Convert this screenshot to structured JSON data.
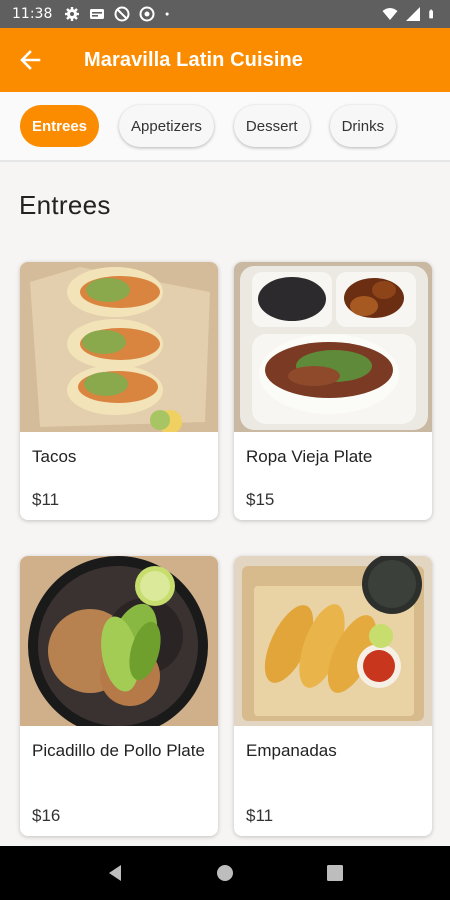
{
  "status_bar": {
    "time": "11:38",
    "left_icons": [
      "gear-icon",
      "sim-card-icon",
      "at-sign-icon",
      "at-sign-icon",
      "dot-icon"
    ],
    "right_icons": [
      "wifi-icon",
      "signal-icon",
      "battery-icon"
    ]
  },
  "app_bar": {
    "title": "Maravilla Latin Cuisine",
    "back_icon": "arrow-left-icon",
    "color": "#fb8c00"
  },
  "categories": [
    {
      "label": "Entrees",
      "active": true
    },
    {
      "label": "Appetizers",
      "active": false
    },
    {
      "label": "Dessert",
      "active": false
    },
    {
      "label": "Drinks",
      "active": false
    }
  ],
  "section": {
    "title": "Entrees"
  },
  "items": [
    {
      "name": "Tacos",
      "price": "$11"
    },
    {
      "name": "Ropa Vieja Plate",
      "price": "$15"
    },
    {
      "name": "Picadillo de Pollo Plate",
      "price": "$16"
    },
    {
      "name": "Empanadas",
      "price": "$11"
    }
  ],
  "nav_bar": {
    "icons": [
      "back-triangle-icon",
      "home-circle-icon",
      "recents-square-icon"
    ]
  }
}
